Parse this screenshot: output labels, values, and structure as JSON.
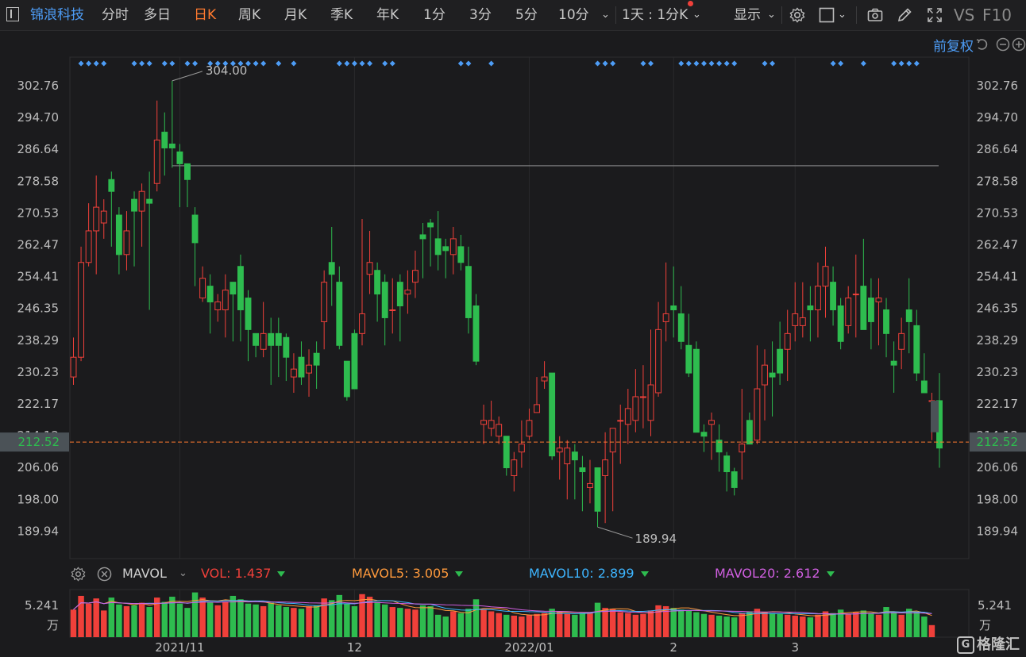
{
  "toolbar": {
    "stock_name": "锦浪科技",
    "periods": [
      "分时",
      "多日",
      "日K",
      "周K",
      "月K",
      "季K",
      "年K",
      "1分",
      "3分",
      "5分",
      "10分"
    ],
    "active_period": "日K",
    "multi_day": "1天 : 1分K",
    "display": "显示",
    "vs": "VS",
    "f10": "F10"
  },
  "adjust": "前复权",
  "colors": {
    "up": "#f0403a",
    "down": "#2ebc4f",
    "price_line": "#ff7a2f",
    "blue": "#4d9cf5",
    "mavol5": "#ff9a3c",
    "mavol10": "#3db5ff",
    "mavol20": "#d05fe0"
  },
  "indicator": {
    "name": "MAVOL",
    "vol_label": "VOL:",
    "vol_value": "1.437",
    "mavol5_label": "MAVOL5:",
    "mavol5_value": "3.005",
    "mavol10_label": "MAVOL10:",
    "mavol10_value": "2.899",
    "mavol20_label": "MAVOL20:",
    "mavol20_value": "2.612"
  },
  "chart_data": {
    "type": "candlestick",
    "y_ticks": [
      "302.76",
      "294.70",
      "286.64",
      "278.58",
      "270.53",
      "262.47",
      "254.41",
      "246.35",
      "238.29",
      "230.23",
      "222.17",
      "214.12",
      "206.06",
      "198.00",
      "189.94"
    ],
    "ylim": [
      183,
      310
    ],
    "current_price": "212.52",
    "high_label": "304.00",
    "low_label": "189.94",
    "x_labels": [
      "2021/11",
      "12",
      "2022/01",
      "2",
      "3"
    ],
    "x_label_index": [
      14,
      37,
      60,
      79,
      95
    ],
    "resistance": 282.5,
    "volume_axis": {
      "top": "5.241",
      "unit": "万"
    },
    "candles": [
      [
        229,
        234,
        239,
        227
      ],
      [
        234,
        258,
        262,
        233
      ],
      [
        258,
        266,
        273,
        257
      ],
      [
        266,
        272,
        280,
        255
      ],
      [
        268,
        271,
        274,
        264
      ],
      [
        279,
        276,
        281,
        262
      ],
      [
        270,
        260,
        272,
        255
      ],
      [
        260,
        266,
        271,
        256
      ],
      [
        274,
        271,
        276,
        257
      ],
      [
        271,
        276,
        278,
        262
      ],
      [
        274,
        273,
        281,
        246
      ],
      [
        278,
        289,
        299,
        276
      ],
      [
        291,
        287,
        296,
        280
      ],
      [
        288,
        287,
        304,
        282
      ],
      [
        286,
        283,
        288,
        272
      ],
      [
        283,
        279,
        283,
        272
      ],
      [
        270,
        263,
        272,
        252
      ],
      [
        249,
        254,
        257,
        248
      ],
      [
        252,
        248,
        255,
        240
      ],
      [
        246,
        248,
        250,
        243
      ],
      [
        246,
        251,
        255,
        239
      ],
      [
        253,
        250,
        253,
        238
      ],
      [
        257,
        246,
        260,
        238
      ],
      [
        249,
        241,
        251,
        233
      ],
      [
        240,
        237,
        240,
        234
      ],
      [
        236,
        240,
        248,
        234
      ],
      [
        240,
        237,
        244,
        227
      ],
      [
        240,
        237,
        244,
        229
      ],
      [
        239,
        234,
        240,
        228
      ],
      [
        229,
        231,
        235,
        225
      ],
      [
        234,
        229,
        238,
        227
      ],
      [
        230,
        232,
        236,
        224
      ],
      [
        235,
        232,
        238,
        226
      ],
      [
        243,
        253,
        256,
        236
      ],
      [
        258,
        255,
        267,
        247
      ],
      [
        253,
        237,
        257,
        236
      ],
      [
        233,
        224,
        233,
        223
      ],
      [
        240,
        226,
        241,
        230
      ],
      [
        240,
        245,
        269,
        237
      ],
      [
        255,
        258,
        266,
        250
      ],
      [
        256,
        250,
        258,
        243
      ],
      [
        253,
        244,
        255,
        237
      ],
      [
        246,
        246,
        254,
        240
      ],
      [
        253,
        247,
        255,
        238
      ],
      [
        250,
        251,
        256,
        245
      ],
      [
        253,
        256,
        261,
        249
      ],
      [
        265,
        264,
        268,
        254
      ],
      [
        268,
        267,
        269,
        257
      ],
      [
        264,
        260,
        271,
        256
      ],
      [
        262,
        261,
        264,
        254
      ],
      [
        260,
        264,
        267,
        255
      ],
      [
        262,
        258,
        265,
        256
      ],
      [
        257,
        244,
        262,
        240
      ],
      [
        247,
        233,
        250,
        232
      ],
      [
        217,
        218,
        222,
        212
      ],
      [
        216,
        218,
        223,
        214
      ],
      [
        214,
        217,
        219,
        212
      ],
      [
        214,
        206,
        214,
        204
      ],
      [
        204,
        208,
        210,
        200
      ],
      [
        210,
        212,
        218,
        206
      ],
      [
        214,
        218,
        221,
        213
      ],
      [
        220,
        222,
        229,
        220
      ],
      [
        228,
        229,
        233,
        226
      ],
      [
        230,
        209,
        230,
        208
      ],
      [
        210,
        211,
        214,
        203
      ],
      [
        207,
        211,
        213,
        198
      ],
      [
        210,
        208,
        212,
        198
      ],
      [
        206,
        205,
        209,
        195
      ],
      [
        201,
        202,
        208,
        197
      ],
      [
        206,
        195,
        206,
        191
      ],
      [
        204,
        208,
        215,
        192
      ],
      [
        210,
        216,
        216,
        195
      ],
      [
        218,
        218,
        222,
        207
      ],
      [
        217,
        221,
        226,
        212
      ],
      [
        218,
        224,
        231,
        215
      ],
      [
        224,
        224,
        232,
        216
      ],
      [
        218,
        227,
        241,
        214
      ],
      [
        225,
        241,
        248,
        224
      ],
      [
        243,
        245,
        258,
        238
      ],
      [
        247,
        246,
        257,
        239
      ],
      [
        245,
        238,
        252,
        236
      ],
      [
        237,
        230,
        245,
        229
      ],
      [
        236,
        215,
        238,
        218
      ],
      [
        215,
        214,
        217,
        210
      ],
      [
        217,
        218,
        220,
        208
      ],
      [
        213,
        210,
        217,
        205
      ],
      [
        209,
        205,
        210,
        200
      ],
      [
        205,
        201,
        206,
        199
      ],
      [
        210,
        212,
        226,
        203
      ],
      [
        218,
        212,
        220,
        212
      ],
      [
        213,
        226,
        237,
        212
      ],
      [
        227,
        232,
        236,
        218
      ],
      [
        230,
        229,
        238,
        219
      ],
      [
        236,
        230,
        243,
        227
      ],
      [
        236,
        240,
        246,
        228
      ],
      [
        242,
        245,
        253,
        238
      ],
      [
        242,
        244,
        253,
        239
      ],
      [
        247,
        246,
        252,
        238
      ],
      [
        246,
        252,
        258,
        239
      ],
      [
        252,
        257,
        262,
        244
      ],
      [
        253,
        246,
        257,
        242
      ],
      [
        247,
        238,
        249,
        236
      ],
      [
        242,
        249,
        252,
        240
      ],
      [
        250,
        250,
        260,
        239
      ],
      [
        252,
        241,
        264,
        241
      ],
      [
        249,
        243,
        254,
        236
      ],
      [
        248,
        249,
        254,
        237
      ],
      [
        246,
        240,
        249,
        234
      ],
      [
        233,
        232,
        238,
        225
      ],
      [
        236,
        240,
        244,
        231
      ],
      [
        246,
        243,
        254,
        235
      ],
      [
        242,
        230,
        246,
        228
      ],
      [
        228,
        225,
        235,
        226
      ],
      [
        223,
        223,
        225,
        213
      ],
      [
        223,
        211,
        230,
        206
      ]
    ],
    "volumes": [
      3.2,
      4.8,
      3.9,
      4.5,
      3.1,
      4.6,
      3.8,
      3.6,
      3.7,
      4.0,
      3.5,
      4.6,
      4.1,
      4.7,
      3.9,
      3.4,
      5.2,
      4.6,
      4.1,
      3.7,
      4.1,
      4.8,
      4.4,
      3.9,
      3.8,
      3.6,
      4.0,
      3.7,
      3.5,
      3.4,
      3.3,
      3.6,
      3.7,
      4.5,
      4.3,
      4.9,
      3.9,
      3.6,
      5.0,
      4.7,
      4.1,
      3.8,
      3.5,
      3.4,
      3.3,
      3.2,
      3.7,
      3.6,
      2.6,
      2.4,
      3.0,
      2.8,
      3.3,
      4.4,
      3.2,
      3.0,
      2.8,
      2.6,
      2.5,
      2.4,
      2.6,
      2.7,
      2.8,
      3.3,
      3.0,
      2.7,
      2.6,
      2.8,
      2.9,
      4.0,
      3.4,
      3.3,
      2.9,
      2.8,
      2.6,
      2.7,
      3.1,
      3.7,
      3.6,
      3.4,
      3.2,
      3.1,
      2.9,
      2.7,
      2.6,
      2.5,
      2.4,
      2.3,
      2.8,
      3.0,
      3.3,
      2.9,
      2.8,
      2.7,
      2.6,
      2.5,
      2.4,
      2.3,
      2.6,
      3.0,
      2.8,
      3.2,
      2.7,
      2.9,
      3.1,
      2.8,
      2.6,
      3.5,
      2.9,
      2.6,
      3.3,
      2.9,
      2.4,
      1.4
    ],
    "markers": [
      1,
      2,
      3,
      4,
      8,
      9,
      10,
      12,
      13,
      15,
      16,
      18,
      19,
      20,
      21,
      22,
      23,
      24,
      25,
      27,
      29,
      35,
      36,
      37,
      38,
      39,
      41,
      42,
      51,
      52,
      55,
      69,
      70,
      71,
      75,
      76,
      80,
      81,
      82,
      83,
      84,
      85,
      86,
      87,
      91,
      92,
      100,
      101,
      104,
      108,
      109,
      110,
      111
    ]
  }
}
